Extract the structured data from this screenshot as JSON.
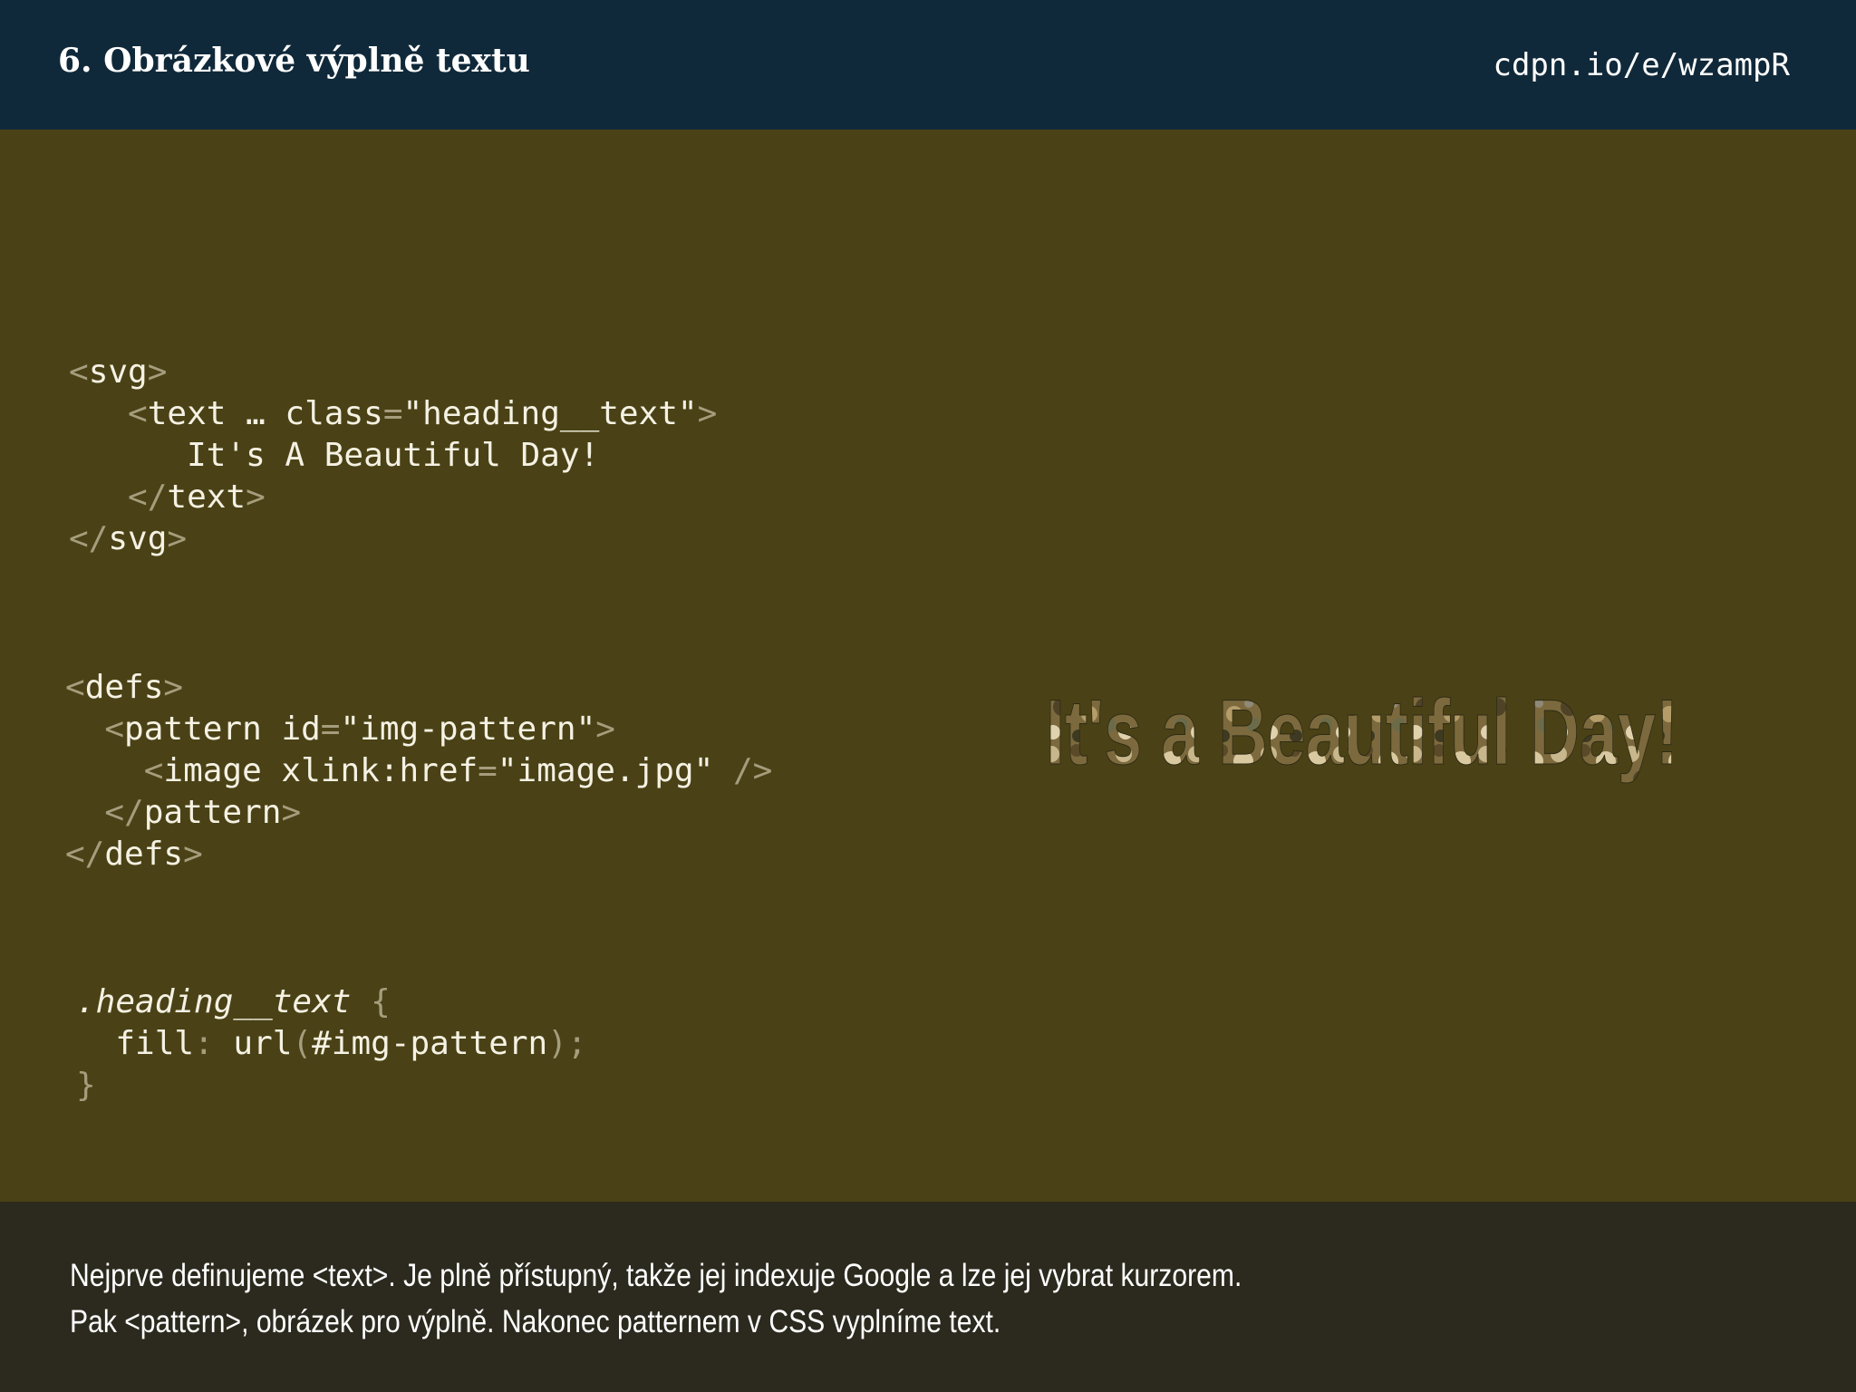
{
  "header": {
    "title": "6. Obrázkové výplně textu",
    "link": "cdpn.io/e/wzampR"
  },
  "code": {
    "svg_block": [
      [
        [
          "p",
          "<"
        ],
        [
          "t",
          "svg"
        ],
        [
          "p",
          ">"
        ]
      ],
      [
        [
          "t",
          "   "
        ],
        [
          "p",
          "<"
        ],
        [
          "t",
          "text … class"
        ],
        [
          "p",
          "="
        ],
        [
          "t",
          "\"heading__text\""
        ],
        [
          "p",
          ">"
        ]
      ],
      [
        [
          "t",
          "      It's A Beautiful Day!"
        ]
      ],
      [
        [
          "t",
          "   "
        ],
        [
          "p",
          "</"
        ],
        [
          "t",
          "text"
        ],
        [
          "p",
          ">"
        ]
      ],
      [
        [
          "p",
          "</"
        ],
        [
          "t",
          "svg"
        ],
        [
          "p",
          ">"
        ]
      ]
    ],
    "defs_block": [
      [
        [
          "p",
          "<"
        ],
        [
          "t",
          "defs"
        ],
        [
          "p",
          ">"
        ]
      ],
      [
        [
          "t",
          "  "
        ],
        [
          "p",
          "<"
        ],
        [
          "t",
          "pattern id"
        ],
        [
          "p",
          "="
        ],
        [
          "t",
          "\"img-pattern\""
        ],
        [
          "p",
          ">"
        ]
      ],
      [
        [
          "t",
          "    "
        ],
        [
          "p",
          "<"
        ],
        [
          "t",
          "image xlink:href"
        ],
        [
          "p",
          "="
        ],
        [
          "t",
          "\"image.jpg\""
        ],
        [
          "p",
          " />"
        ]
      ],
      [
        [
          "t",
          "  "
        ],
        [
          "p",
          "</"
        ],
        [
          "t",
          "pattern"
        ],
        [
          "p",
          ">"
        ]
      ],
      [
        [
          "p",
          "</"
        ],
        [
          "t",
          "defs"
        ],
        [
          "p",
          ">"
        ]
      ]
    ],
    "css_block": [
      [
        [
          "i",
          ".heading__text"
        ],
        [
          "p",
          " {"
        ]
      ],
      [
        [
          "t",
          "  fill"
        ],
        [
          "p",
          ": "
        ],
        [
          "t",
          "url"
        ],
        [
          "p",
          "("
        ],
        [
          "t",
          "#img-pattern"
        ],
        [
          "p",
          ");"
        ]
      ],
      [
        [
          "p",
          "}"
        ]
      ]
    ]
  },
  "demo": {
    "text": "It's a Beautiful Day!"
  },
  "footer": {
    "line1": "Nejprve definujeme <text>. Je plně přístupný, takže jej indexuje Google a lze jej vybrat kurzorem.",
    "line2": "Pak <pattern>, obrázek pro výplně. Nakonec patternem v CSS vyplníme text."
  }
}
